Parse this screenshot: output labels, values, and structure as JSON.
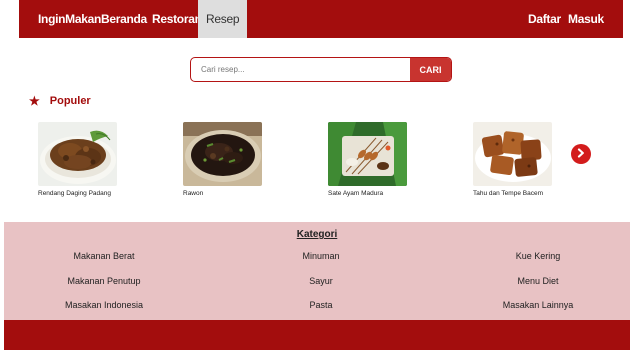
{
  "nav": {
    "brand": "InginMakan",
    "links": [
      "Beranda",
      "Restoran",
      "Resep"
    ],
    "right": [
      "Daftar",
      "Masuk"
    ],
    "active": "Resep"
  },
  "search": {
    "placeholder": "Cari resep...",
    "button": "CARI"
  },
  "populer": {
    "title": "Populer",
    "items": [
      {
        "caption": "Rendang Daging Padang"
      },
      {
        "caption": "Rawon"
      },
      {
        "caption": "Sate Ayam Madura"
      },
      {
        "caption": "Tahu dan Tempe Bacem"
      }
    ],
    "next_icon": "chevron-right-icon"
  },
  "kategori": {
    "title": "Kategori",
    "items": [
      "Makanan Berat",
      "Minuman",
      "Kue Kering",
      "Makanan Penutup",
      "Sayur",
      "Menu Diet",
      "Masakan Indonesia",
      "Pasta",
      "Masakan Lainnya"
    ]
  },
  "colors": {
    "brand": "#a30d0d",
    "accent": "#c8342f",
    "kategori_bg": "#e8c2c4"
  }
}
